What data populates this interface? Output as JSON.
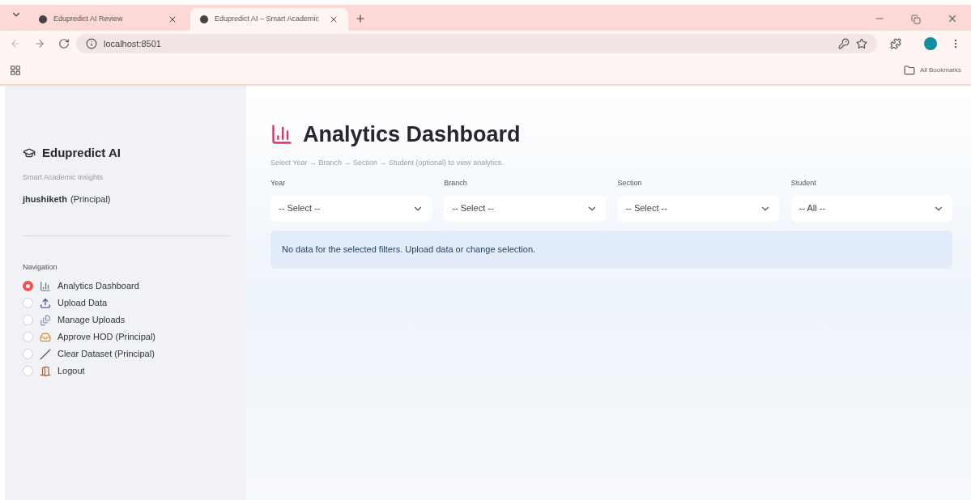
{
  "browser": {
    "tabs": [
      {
        "title": "Edupredict AI Review",
        "selected": false
      },
      {
        "title": "Edupredict AI – Smart Academic",
        "selected": true
      }
    ],
    "url": "localhost:8501",
    "bookmarks_label": "All Bookmarks"
  },
  "sidebar": {
    "app_title": "Edupredict AI",
    "tagline": "Smart Academic Insights",
    "user_name": "jhushiketh",
    "user_role": "(Principal)",
    "nav_label": "Navigation",
    "items": [
      {
        "label": "Analytics Dashboard",
        "kind": "chart",
        "selected": true
      },
      {
        "label": "Upload Data",
        "kind": "upload",
        "selected": false
      },
      {
        "label": "Manage Uploads",
        "kind": "files",
        "selected": false
      },
      {
        "label": "Approve HOD (Principal)",
        "kind": "inbox",
        "selected": false
      },
      {
        "label": "Clear Dataset (Principal)",
        "kind": "broom",
        "selected": false
      },
      {
        "label": "Logout",
        "kind": "door",
        "selected": false
      }
    ]
  },
  "main": {
    "title": "Analytics Dashboard",
    "hint": "Select Year → Branch → Section → Student (optional) to view analytics.",
    "filters": [
      {
        "label": "Year",
        "value": "-- Select --"
      },
      {
        "label": "Branch",
        "value": "-- Select --"
      },
      {
        "label": "Section",
        "value": "-- Select --"
      },
      {
        "label": "Student",
        "value": "-- All --"
      }
    ],
    "message": "No data for the selected filters. Upload data or change selection."
  }
}
